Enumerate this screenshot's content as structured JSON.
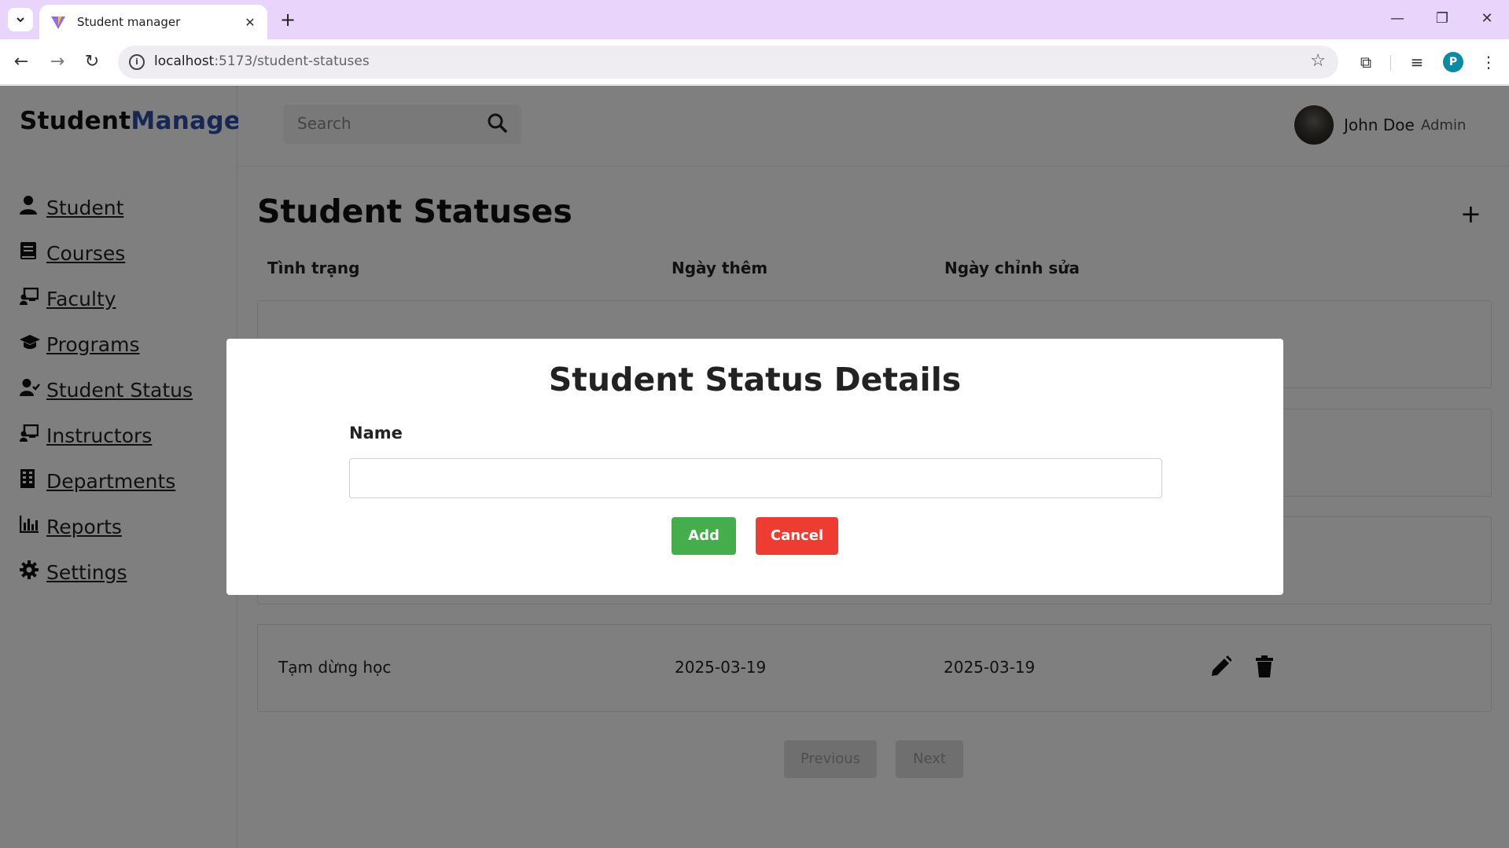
{
  "browser": {
    "tab_title": "Student manager",
    "url_host": "localhost",
    "url_rest": ":5173/student-statuses",
    "profile_initial": "P"
  },
  "brand": {
    "part1": "Student",
    "part2": "Manager"
  },
  "sidebar": {
    "items": [
      {
        "label": "Student",
        "icon": "user-icon"
      },
      {
        "label": "Courses",
        "icon": "book-icon"
      },
      {
        "label": "Faculty",
        "icon": "chalkboard-teacher-icon"
      },
      {
        "label": "Programs",
        "icon": "graduation-cap-icon"
      },
      {
        "label": "Student Status",
        "icon": "user-check-icon"
      },
      {
        "label": "Instructors",
        "icon": "chalkboard-teacher-icon"
      },
      {
        "label": "Departments",
        "icon": "building-icon"
      },
      {
        "label": "Reports",
        "icon": "bar-chart-icon"
      },
      {
        "label": "Settings",
        "icon": "gear-icon"
      }
    ]
  },
  "topbar": {
    "search_placeholder": "Search",
    "user_name": "John Doe",
    "user_role": "Admin"
  },
  "main": {
    "title": "Student Statuses",
    "columns": [
      "Tình trạng",
      "Ngày thêm",
      "Ngày chỉnh sửa"
    ],
    "rows": [
      {
        "status": "",
        "added": "",
        "modified": ""
      },
      {
        "status": "",
        "added": "",
        "modified": ""
      },
      {
        "status": "",
        "added": "",
        "modified": ""
      },
      {
        "status": "Tạm dừng học",
        "added": "2025-03-19",
        "modified": "2025-03-19"
      }
    ],
    "pager": {
      "previous": "Previous",
      "next": "Next"
    }
  },
  "modal": {
    "title": "Student Status Details",
    "field_label": "Name",
    "field_value": "",
    "add_label": "Add",
    "cancel_label": "Cancel"
  },
  "colors": {
    "brand_accent": "#2f4ea8",
    "add_button": "#45ad4c",
    "cancel_button": "#ef3c33",
    "tabstrip": "#e9d5fb"
  }
}
